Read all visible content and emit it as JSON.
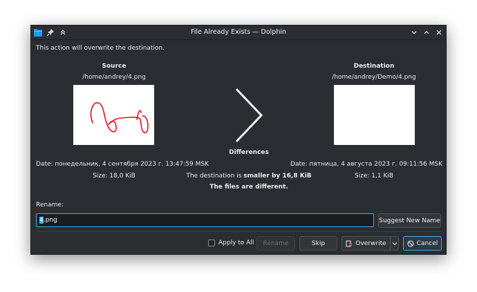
{
  "window": {
    "title": "File Already Exists — Dolphin",
    "message": "This action will overwrite the destination."
  },
  "source": {
    "heading": "Source",
    "path": "/home/andrey/4.png",
    "date": "Date: понедельник, 4 сентября 2023 г. 13:47:59 MSK",
    "size": "Size: 18,0 KiB"
  },
  "destination": {
    "heading": "Destination",
    "path": "/home/andrey/Demo/4.png",
    "date": "Date: пятница, 4 августа 2023 г. 09:11:56 MSK",
    "size": "Size: 1,1 KiB"
  },
  "differences": {
    "heading": "Differences",
    "line1_prefix": "The destination is ",
    "line1_bold": "smaller by 16,8 KiB",
    "line2": "The files are different."
  },
  "rename": {
    "label": "Rename:",
    "value_selected": "4",
    "value_rest": ".png",
    "suggest_label": "Suggest New Name"
  },
  "footer": {
    "apply_all_label": "Apply to All",
    "apply_all_checked": false,
    "rename_button": "Rename",
    "skip_button": "Skip",
    "overwrite_button": "Overwrite",
    "cancel_button": "Cancel"
  },
  "colors": {
    "window_bg": "#2a2e32",
    "accent": "#3daee9",
    "sketch": "#e0101a"
  },
  "icons": [
    "dolphin-app-icon",
    "pin-icon",
    "keep-above-icon",
    "minimize-icon",
    "maximize-icon",
    "close-icon",
    "arrow-right-icon",
    "overwrite-icon",
    "cancel-icon",
    "chevron-down-icon"
  ]
}
